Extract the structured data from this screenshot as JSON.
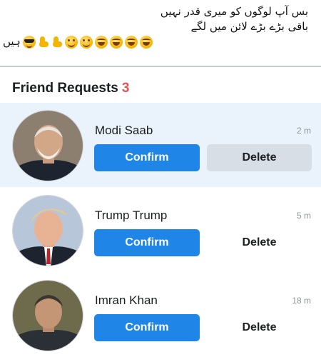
{
  "caption": {
    "line1": "بس آپ لوگوں کو میری قدر نہیں",
    "line2": "باقی بڑے بڑے لائن میں لگے",
    "line3_prefix": "ہیں",
    "emojis": [
      "cool-emoji",
      "flexed-arm",
      "flexed-arm",
      "smiling-emoji",
      "smiling-emoji",
      "laughing-emoji",
      "laughing-emoji",
      "laughing-emoji",
      "laughing-emoji"
    ]
  },
  "header": {
    "title": "Friend Requests",
    "count": "3"
  },
  "requests": [
    {
      "name": "Modi Saab",
      "time": "2 m",
      "confirm": "Confirm",
      "delete": "Delete"
    },
    {
      "name": "Trump Trump",
      "time": "5 m",
      "confirm": "Confirm",
      "delete": "Delete"
    },
    {
      "name": "Imran Khan",
      "time": "18 m",
      "confirm": "Confirm",
      "delete": "Delete"
    }
  ],
  "colors": {
    "accent": "#1f86e8",
    "count": "#e4574f",
    "highlight": "#eaf3fb"
  }
}
